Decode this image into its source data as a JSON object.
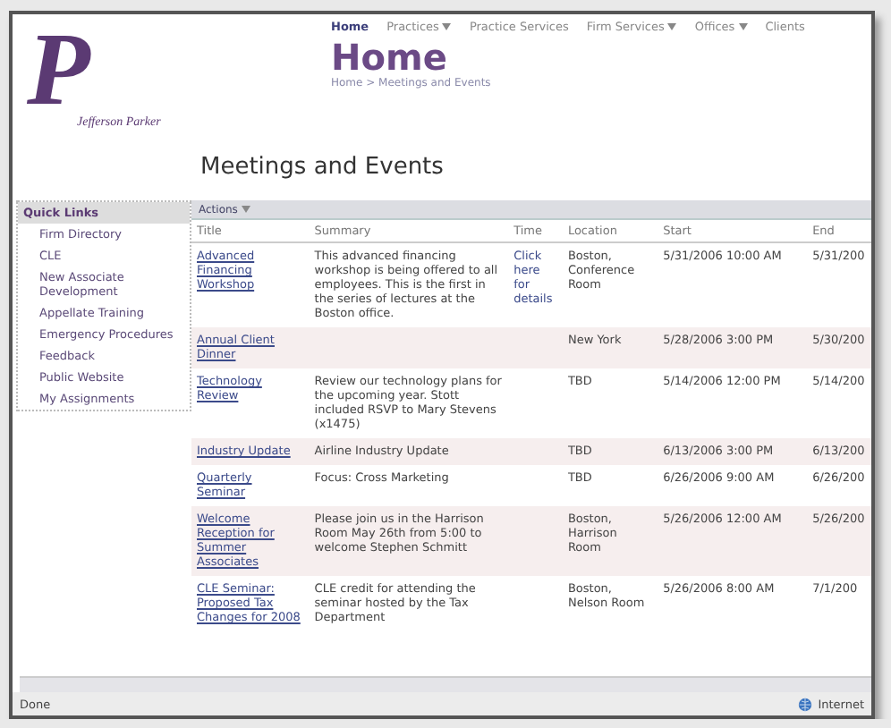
{
  "logo": {
    "mark": "P",
    "name": "Jefferson Parker"
  },
  "nav": [
    {
      "label": "Home",
      "selected": true,
      "dropdown": false
    },
    {
      "label": "Practices",
      "selected": false,
      "dropdown": true
    },
    {
      "label": "Practice Services",
      "selected": false,
      "dropdown": false
    },
    {
      "label": "Firm Services",
      "selected": false,
      "dropdown": true
    },
    {
      "label": "Offices",
      "selected": false,
      "dropdown": true
    },
    {
      "label": "Clients",
      "selected": false,
      "dropdown": false
    }
  ],
  "page_title": "Home",
  "breadcrumb": "Home > Meetings and Events",
  "heading": "Meetings and Events",
  "quick_links": {
    "title": "Quick Links",
    "items": [
      "Firm Directory",
      "CLE",
      "New Associate Development",
      "Appellate Training",
      "Emergency Procedures",
      "Feedback",
      "Public Website",
      "My Assignments"
    ]
  },
  "toolbar": {
    "actions": "Actions"
  },
  "table": {
    "columns": [
      "Title",
      "Summary",
      "Time",
      "Location",
      "Start",
      "End"
    ],
    "rows": [
      {
        "title": "Advanced Financing Workshop",
        "summary": "This advanced financing workshop is being offered to all employees. This is the first in the series of lectures at the Boston office.",
        "time": "Click here for details",
        "location": "Boston, Conference Room",
        "start": "5/31/2006 10:00 AM",
        "end": "5/31/200"
      },
      {
        "title": "Annual Client Dinner",
        "summary": "",
        "time": "",
        "location": "New York",
        "start": "5/28/2006 3:00 PM",
        "end": "5/30/200"
      },
      {
        "title": "Technology Review",
        "summary": "Review our technology plans for the upcoming year. Stott included RSVP to Mary Stevens (x1475)",
        "time": "",
        "location": "TBD",
        "start": "5/14/2006 12:00 PM",
        "end": "5/14/200"
      },
      {
        "title": "Industry Update",
        "summary": "Airline Industry Update",
        "time": "",
        "location": "TBD",
        "start": "6/13/2006 3:00 PM",
        "end": "6/13/200"
      },
      {
        "title": "Quarterly Seminar",
        "summary": "Focus: Cross Marketing",
        "time": "",
        "location": "TBD",
        "start": "6/26/2006 9:00 AM",
        "end": "6/26/200"
      },
      {
        "title": "Welcome Reception for Summer Associates",
        "summary": "Please join us in the Harrison Room May 26th from 5:00 to welcome Stephen Schmitt",
        "time": "",
        "location": "Boston, Harrison Room",
        "start": "5/26/2006 12:00 AM",
        "end": "5/26/200"
      },
      {
        "title": "CLE Seminar: Proposed Tax Changes for 2008",
        "summary": "CLE credit for attending the seminar hosted by the Tax Department",
        "time": "",
        "location": "Boston, Nelson Room",
        "start": "5/26/2006 8:00 AM",
        "end": "7/1/200"
      }
    ]
  },
  "status_bar": {
    "text": "Done",
    "zone": "Internet"
  }
}
